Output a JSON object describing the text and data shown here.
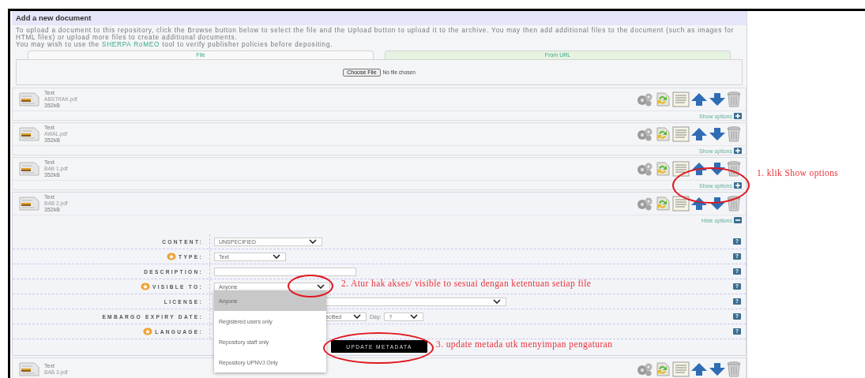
{
  "panel": {
    "title": "Add a new document",
    "intro": "To upload a document to this repository, click the Browse button below to select the file and the Upload button to upload it to the archive. You may then add additional files to the document (such as images for HTML files) or upload more files to create additional documents.",
    "note_before": "You may wish to use the ",
    "note_link": "SHERPA RoMEO",
    "note_after": " tool to verify publisher policies before depositing."
  },
  "tabs": [
    {
      "label": "File",
      "selected": true
    },
    {
      "label": "From URL",
      "selected": false
    }
  ],
  "file_input": {
    "button": "Choose File",
    "status": "No file chosen"
  },
  "documents": [
    {
      "type": "Text",
      "filename": "ABSTRAK.pdf",
      "size": "352kB",
      "toggle": "Show options",
      "expanded": false
    },
    {
      "type": "Text",
      "filename": "AWAL.pdf",
      "size": "352kB",
      "toggle": "Show options",
      "expanded": false
    },
    {
      "type": "Text",
      "filename": "BAB 1.pdf",
      "size": "352kB",
      "toggle": "Show options",
      "expanded": false
    },
    {
      "type": "Text",
      "filename": "BAB 2.pdf",
      "size": "352kB",
      "toggle": "Hide options",
      "expanded": true
    },
    {
      "type": "Text",
      "filename": "BAB 3.pdf",
      "expanded": false
    }
  ],
  "form": {
    "fields": [
      {
        "kind": "select",
        "label": "CONTENT:",
        "required": false,
        "value": "UNSPECIFIED",
        "help": "?"
      },
      {
        "kind": "select",
        "label": "TYPE:",
        "required": true,
        "value": "Text",
        "help": "?"
      },
      {
        "kind": "text",
        "label": "DESCRIPTION:",
        "required": false,
        "help": "?"
      },
      {
        "kind": "select",
        "label": "VISIBLE TO:",
        "required": true,
        "value": "Anyone",
        "help": "?",
        "open": true
      },
      {
        "kind": "select",
        "label": "LICENSE:",
        "required": false,
        "help": "?"
      },
      {
        "kind": "date",
        "label": "EMBARGO EXPIRY DATE:",
        "required": false,
        "month": "ecified",
        "day_label": "Day:",
        "day": "?",
        "help": "?"
      },
      {
        "kind": "select",
        "label": "LANGUAGE:",
        "required": true,
        "help": "?"
      }
    ],
    "update_button": "UPDATE METADATA"
  },
  "dropdown": {
    "options": [
      {
        "label": "Anyone",
        "selected": true
      },
      {
        "label": "Registered users only",
        "selected": false
      },
      {
        "label": "Repository staff only",
        "selected": false
      },
      {
        "label": "Repository UPNVJ Only",
        "selected": false
      }
    ]
  },
  "annotations": [
    {
      "text": "1. klik Show options"
    },
    {
      "text": "2. Atur hak akses/ visible to sesuai dengan ketentuan setiap file"
    },
    {
      "text": "3. update metada utk menyimpan pengaturan"
    }
  ]
}
